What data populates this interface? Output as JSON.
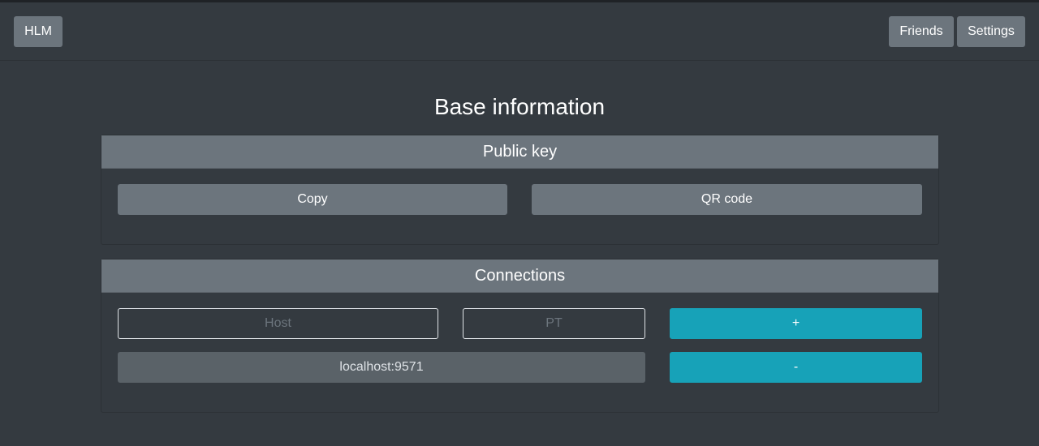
{
  "navbar": {
    "brand": "HLM",
    "friends_label": "Friends",
    "settings_label": "Settings"
  },
  "page": {
    "title": "Base information"
  },
  "public_key": {
    "header": "Public key",
    "copy_label": "Copy",
    "qr_label": "QR code"
  },
  "connections": {
    "header": "Connections",
    "host_placeholder": "Host",
    "pt_placeholder": "PT",
    "add_label": "+",
    "remove_label": "-",
    "items": [
      "localhost:9571"
    ]
  },
  "colors": {
    "background": "#343a40",
    "secondary": "#6c757d",
    "info": "#17a2b8"
  }
}
